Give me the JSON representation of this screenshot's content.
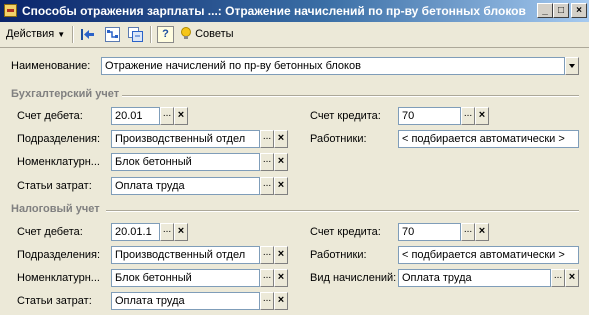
{
  "window": {
    "title": "Способы отражения зарплаты ...: Отражение начислений по пр-ву бетонных блоков",
    "minimize": "_",
    "maximize": "□",
    "close": "×"
  },
  "toolbar": {
    "actions_label": "Действия",
    "tips_label": "Советы",
    "help_glyph": "?"
  },
  "form": {
    "name_label": "Наименование:",
    "name_value": "Отражение начислений по пр-ву бетонных блоков",
    "dots": "...",
    "clear": "×",
    "accounting": {
      "section": "Бухгалтерский учет",
      "debit_label": "Счет дебета:",
      "debit_value": "20.01",
      "department_label": "Подразделения:",
      "department_value": "Производственный отдел",
      "nomenclature_label": "Номенклатурн...",
      "nomenclature_value": "Блок бетонный",
      "cost_label": "Статьи затрат:",
      "cost_value": "Оплата труда",
      "credit_label": "Счет кредита:",
      "credit_value": "70",
      "employees_label": "Работники:",
      "employees_value": "< подбирается автоматически >"
    },
    "tax": {
      "section": "Налоговый учет",
      "debit_label": "Счет дебета:",
      "debit_value": "20.01.1",
      "department_label": "Подразделения:",
      "department_value": "Производственный отдел",
      "nomenclature_label": "Номенклатурн...",
      "nomenclature_value": "Блок бетонный",
      "cost_label": "Статьи затрат:",
      "cost_value": "Оплата труда",
      "credit_label": "Счет кредита:",
      "credit_value": "70",
      "employees_label": "Работники:",
      "employees_value": "< подбирается автоматически >",
      "accrual_type_label": "Вид начислений:",
      "accrual_type_value": "Оплата труда"
    }
  }
}
